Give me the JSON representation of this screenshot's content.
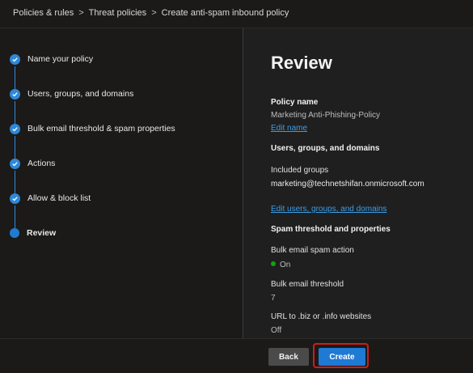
{
  "breadcrumb": {
    "items": [
      "Policies & rules",
      "Threat policies",
      "Create anti-spam inbound policy"
    ],
    "separator": ">"
  },
  "steps": [
    {
      "label": "Name your policy",
      "state": "complete"
    },
    {
      "label": "Users, groups, and domains",
      "state": "complete"
    },
    {
      "label": "Bulk email threshold & spam properties",
      "state": "complete"
    },
    {
      "label": "Actions",
      "state": "complete"
    },
    {
      "label": "Allow & block list",
      "state": "complete"
    },
    {
      "label": "Review",
      "state": "current"
    }
  ],
  "review": {
    "title": "Review",
    "policy_name_heading": "Policy name",
    "policy_name_value": "Marketing Anti-Phishing-Policy",
    "edit_name_link": "Edit name",
    "users_heading": "Users, groups, and domains",
    "included_groups_label": "Included groups",
    "included_groups_value": "marketing@technetshifan.onmicrosoft.com",
    "edit_users_link": "Edit users, groups, and domains",
    "spam_heading": "Spam threshold and properties",
    "bulk_action_label": "Bulk email spam action",
    "bulk_action_value": "On",
    "bulk_threshold_label": "Bulk email threshold",
    "bulk_threshold_value": "7",
    "url_biz_label": "URL to .biz or .info websites",
    "url_biz_value": "Off"
  },
  "footer": {
    "back_label": "Back",
    "create_label": "Create"
  },
  "colors": {
    "accent": "#1e7ad4",
    "link": "#3a9ee8",
    "status_on": "#13a10e",
    "highlight": "#d01c1c"
  }
}
